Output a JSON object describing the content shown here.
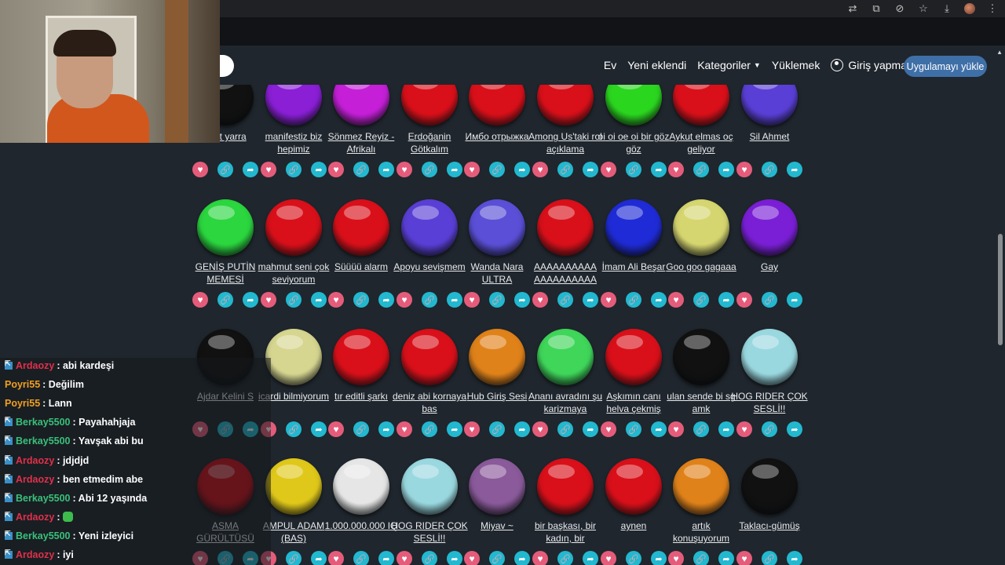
{
  "nav": {
    "links": [
      "Ev",
      "Yeni eklendi",
      "Kategoriler",
      "Yüklemek",
      "Giriş yapmak"
    ],
    "install_button": "Uygulamayı yükle"
  },
  "rows": [
    [
      {
        "label": "Ö                at yarra",
        "color": "#111111"
      },
      {
        "label": "manifestiz biz hepimiz",
        "color": "#8a1fd6"
      },
      {
        "label": "Sönmez Reyiz - Afrikalı",
        "color": "#c51fd8"
      },
      {
        "label": "Erdoğanin Götkalım",
        "color": "#d9101a"
      },
      {
        "label": "Имбо отрыжка",
        "color": "#d9101a"
      },
      {
        "label": "Among Us'taki rol açıklama",
        "color": "#d9101a"
      },
      {
        "label": "oi oi oe oi bir göz göz",
        "color": "#2bd61f"
      },
      {
        "label": "Aykut elmas oç geliyor",
        "color": "#d9101a"
      },
      {
        "label": "Sil Ahmet",
        "color": "#5a3fd6"
      }
    ],
    [
      {
        "label": "GENİŞ PUTİN MEMESİ",
        "color": "#2bd63f"
      },
      {
        "label": "mahmut seni çok seviyorum",
        "color": "#d9101a"
      },
      {
        "label": "Süüüü alarm",
        "color": "#d9101a"
      },
      {
        "label": "Apoyu sevişmem",
        "color": "#5a3fd6"
      },
      {
        "label": "Wanda Nara ULTRA",
        "color": "#5a4fd6"
      },
      {
        "label": "AAAAAAAAAA AAAAAAAAAA",
        "color": "#d9101a"
      },
      {
        "label": "İmam Ali Beşar",
        "color": "#1f2bd6"
      },
      {
        "label": "Goo goo gagaaa",
        "color": "#d6d670"
      },
      {
        "label": "Gay",
        "color": "#7a1fd6"
      }
    ],
    [
      {
        "label": "Ajdar Kelini S",
        "color": "#111111"
      },
      {
        "label": "icardi bilmiyorum",
        "color": "#d6d690"
      },
      {
        "label": "tır editli şarkı",
        "color": "#d9101a"
      },
      {
        "label": "deniz abi kornaya bas",
        "color": "#d9101a"
      },
      {
        "label": "Hub Giriş Sesi",
        "color": "#e0821a"
      },
      {
        "label": "Ananı avradını şu karizmaya",
        "color": "#3fd65a"
      },
      {
        "label": "Aşkımın canı helva çekmiş",
        "color": "#d9101a"
      },
      {
        "label": "ulan sende bi sg amk",
        "color": "#111111"
      },
      {
        "label": "HOG RIDER ÇOK SESLİ!!",
        "color": "#9ad8e0"
      }
    ],
    [
      {
        "label": "ASMA GÜRÜLTÜSÜ",
        "color": "#c9101a"
      },
      {
        "label": "AMPUL ADAM (BAS)",
        "color": "#e0c81a"
      },
      {
        "label": "1.000.000.000 IQ",
        "color": "#e6e6e6"
      },
      {
        "label": "HOG RIDER ÇOK SESLİ!!",
        "color": "#9ad8e0"
      },
      {
        "label": "Miyav ~",
        "color": "#8a5a9a"
      },
      {
        "label": "bir başkası, bir kadın, bir",
        "color": "#d9101a"
      },
      {
        "label": "aynen",
        "color": "#d9101a"
      },
      {
        "label": "artık konuşuyorum",
        "color": "#e0821a"
      },
      {
        "label": "Taklacı-gümüş",
        "color": "#111111"
      }
    ]
  ],
  "chat": [
    {
      "user": "Ardaozy",
      "color": "#e0304a",
      "badge": true,
      "msg": ": abi kardeşi"
    },
    {
      "user": "Poyri55",
      "color": "#f0a020",
      "badge": false,
      "msg": ": Değilim"
    },
    {
      "user": "Poyri55",
      "color": "#f0a020",
      "badge": false,
      "msg": ": Lann"
    },
    {
      "user": "Berkay5500",
      "color": "#3ac07a",
      "badge": true,
      "msg": ": Payahahjaja"
    },
    {
      "user": "Berkay5500",
      "color": "#3ac07a",
      "badge": true,
      "msg": ": Yavşak abi bu"
    },
    {
      "user": "Ardaozy",
      "color": "#e0304a",
      "badge": true,
      "msg": ": jdjdjd"
    },
    {
      "user": "Ardaozy",
      "color": "#e0304a",
      "badge": true,
      "msg": ": ben etmedim abe"
    },
    {
      "user": "Berkay5500",
      "color": "#3ac07a",
      "badge": true,
      "msg": ": Abi 12 yaşında"
    },
    {
      "user": "Ardaozy",
      "color": "#e0304a",
      "badge": true,
      "msg": ":",
      "emote": true
    },
    {
      "user": "Berkay5500",
      "color": "#3ac07a",
      "badge": true,
      "msg": ": Yeni izleyici"
    },
    {
      "user": "Ardaozy",
      "color": "#e0304a",
      "badge": true,
      "msg": ": iyi"
    }
  ]
}
